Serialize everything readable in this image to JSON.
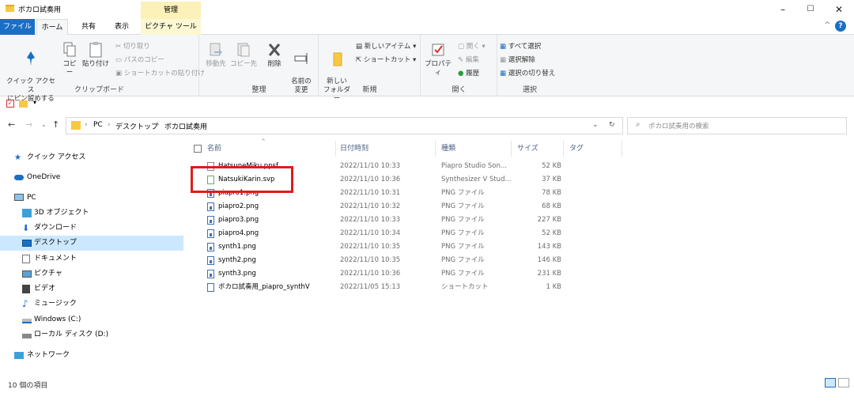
{
  "window": {
    "title": "ボカロ試奏用",
    "context_tab_group": "管理",
    "controls": [
      "–",
      "☐",
      "✕"
    ]
  },
  "ribbon_tabs": [
    "ファイル",
    "ホーム",
    "共有",
    "表示",
    "ピクチャ ツール"
  ],
  "ribbon": {
    "clipboard": {
      "label": "クリップボード",
      "pin": "クイック アクセス\nにピン留めする",
      "copy": "コピー",
      "paste": "貼り付け",
      "cut": "切り取り",
      "copy_path": "パスのコピー",
      "paste_shortcut": "ショートカットの貼り付け"
    },
    "organize": {
      "label": "整理",
      "move_to": "移動先",
      "copy_to": "コピー先",
      "delete": "削除",
      "rename": "名前の\n変更"
    },
    "new": {
      "label": "新規",
      "new_folder": "新しい\nフォルダー",
      "new_item": "新しいアイテム ▾",
      "shortcut": "ショートカット ▾"
    },
    "open": {
      "label": "開く",
      "properties": "プロパティ",
      "open": "開く ▾",
      "edit": "編集",
      "history": "履歴"
    },
    "select": {
      "label": "選択",
      "select_all": "すべて選択",
      "select_none": "選択解除",
      "invert": "選択の切り替え"
    }
  },
  "address": {
    "breadcrumbs": [
      "PC",
      "デスクトップ",
      "ボカロ試奏用"
    ],
    "search_placeholder": "ボカロ試奏用の検索"
  },
  "nav": [
    {
      "label": "クイック アクセス",
      "icon": "star-icon"
    },
    {
      "label": "OneDrive",
      "icon": "cloud-icon"
    },
    {
      "label": "PC",
      "icon": "pc-icon"
    },
    {
      "label": "3D オブジェクト",
      "icon": "cube-icon"
    },
    {
      "label": "ダウンロード",
      "icon": "download-icon"
    },
    {
      "label": "デスクトップ",
      "icon": "desktop-icon",
      "selected": true
    },
    {
      "label": "ドキュメント",
      "icon": "document-icon"
    },
    {
      "label": "ピクチャ",
      "icon": "picture-icon"
    },
    {
      "label": "ビデオ",
      "icon": "video-icon"
    },
    {
      "label": "ミュージック",
      "icon": "music-icon"
    },
    {
      "label": "Windows (C:)",
      "icon": "drive-icon"
    },
    {
      "label": "ローカル ディスク (D:)",
      "icon": "drive-icon"
    },
    {
      "label": "ネットワーク",
      "icon": "network-icon"
    }
  ],
  "columns": {
    "name": "名前",
    "date": "日付時刻",
    "type": "種類",
    "size": "サイズ",
    "tag": "タグ"
  },
  "files": [
    {
      "name": "HatsuneMiku.ppsf",
      "date": "2022/11/10 10:33",
      "type": "Piapro Studio Son...",
      "size": "52 KB",
      "icon": "file-icon"
    },
    {
      "name": "NatsukiKarin.svp",
      "date": "2022/11/10 10:36",
      "type": "Synthesizer V Stud...",
      "size": "37 KB",
      "icon": "svp-file-icon"
    },
    {
      "name": "piapro1.png",
      "date": "2022/11/10 10:31",
      "type": "PNG ファイル",
      "size": "78 KB",
      "icon": "png-file-icon"
    },
    {
      "name": "piapro2.png",
      "date": "2022/11/10 10:32",
      "type": "PNG ファイル",
      "size": "68 KB",
      "icon": "png-file-icon"
    },
    {
      "name": "piapro3.png",
      "date": "2022/11/10 10:33",
      "type": "PNG ファイル",
      "size": "227 KB",
      "icon": "png-file-icon"
    },
    {
      "name": "piapro4.png",
      "date": "2022/11/10 10:34",
      "type": "PNG ファイル",
      "size": "52 KB",
      "icon": "png-file-icon"
    },
    {
      "name": "synth1.png",
      "date": "2022/11/10 10:35",
      "type": "PNG ファイル",
      "size": "143 KB",
      "icon": "png-file-icon"
    },
    {
      "name": "synth2.png",
      "date": "2022/11/10 10:35",
      "type": "PNG ファイル",
      "size": "146 KB",
      "icon": "png-file-icon"
    },
    {
      "name": "synth3.png",
      "date": "2022/11/10 10:36",
      "type": "PNG ファイル",
      "size": "231 KB",
      "icon": "png-file-icon"
    },
    {
      "name": "ボカロ試奏用_piapro_synthV",
      "date": "2022/11/05 15:13",
      "type": "ショートカット",
      "size": "1 KB",
      "icon": "shortcut-icon"
    }
  ],
  "status": {
    "item_count": "10 個の項目"
  },
  "colors": {
    "file_tab": "#1a6fc4",
    "selected_nav": "#cce8ff",
    "highlight_box": "#e01b1b",
    "manage_tab": "#fbf1b9"
  }
}
